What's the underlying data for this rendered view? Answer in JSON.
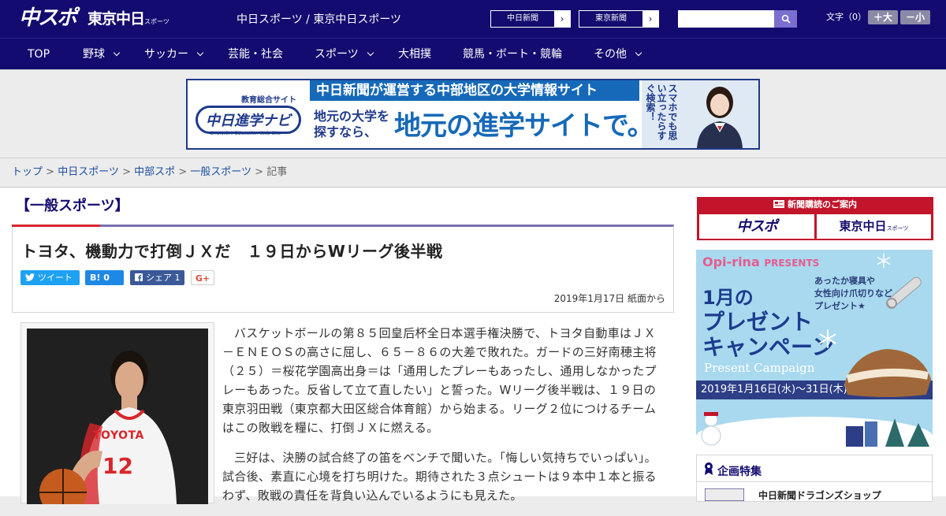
{
  "header": {
    "logo_main": "中スポ",
    "logo_tokyo": "東京中日",
    "logo_tokyo_small": "スポーツ",
    "tagline": "中日スポーツ / 東京中日スポーツ",
    "btn_chunichi": "中日新聞",
    "btn_tokyo": "東京新聞",
    "search_placeholder": "",
    "font_size_label": "文字（0）",
    "font_bigger": "＋大",
    "font_smaller": "－小"
  },
  "nav": {
    "items": [
      {
        "label": "TOP"
      },
      {
        "label": "野球"
      },
      {
        "label": "サッカー"
      },
      {
        "label": "芸能・社会"
      },
      {
        "label": "スポーツ"
      },
      {
        "label": "大相撲"
      },
      {
        "label": "競馬・ボート・競輪"
      },
      {
        "label": "その他"
      }
    ]
  },
  "banner": {
    "caption": "教育総合サイト",
    "logo": "中日進学ナビ",
    "logo_sub": "CHUNICHI Education Web Site",
    "top_text": "中日新聞が運営する中部地区の大学情報サイト",
    "small_text_1": "地元の大学を",
    "small_text_2": "探すなら、",
    "big_text": "地元の進学サイトで。",
    "vertical_text": "スマホでも思い立ったらすぐ検索！"
  },
  "breadcrumb": {
    "items": [
      "トップ",
      "中日スポーツ",
      "中部スポ",
      "一般スポーツ"
    ],
    "current": "記事",
    "sep": " > "
  },
  "article": {
    "section": "【一般スポーツ】",
    "headline": "トヨタ、機動力で打倒ＪＸだ　１９日からWリーグ後半戦",
    "share": {
      "tweet": "ツイート",
      "hatena": "B! 0",
      "facebook": "シェア 1",
      "gplus": "G+"
    },
    "dateline": "2019年1月17日 紙面から",
    "paragraphs": [
      "バスケットボールの第８５回皇后杯全日本選手権決勝で、トヨタ自動車はＪＸ－ＥＮＥＯＳの高さに屈し、６５－８６の大差で敗れた。ガードの三好南穂主将（２５）＝桜花学園高出身＝は「通用したプレーもあったし、通用しなかったプレーもあった。反省して立て直したい」と誓った。Wリーグ後半戦は、１９日の東京羽田戦（東京都大田区総合体育館）から始まる。リーグ２位につけるチームはこの敗戦を糧に、打倒ＪＸに燃える。",
      "三好は、決勝の試合終了の笛をベンチで聞いた。「悔しい気持ちでいっぱい」。試合後、素直に心境を打ち明けた。期待された３点シュートは９本中１本と振るわず、敗戦の責任を背負い込んでいるようにも見えた。"
    ],
    "photo": {
      "jersey_team": "TOYOTA",
      "jersey_number": "12"
    }
  },
  "sidebar": {
    "subscribe_header": "新聞購読のご案内",
    "subscribe_btn1": "中スポ",
    "subscribe_btn2": "東京中日",
    "subscribe_btn2_small": "スポーツ",
    "ad": {
      "brand": "Opi-rina",
      "brand_suffix": "PRESENTS",
      "sub_1": "あったか寝具や",
      "sub_2": "女性向け爪切りなど",
      "sub_3": "プレゼント★",
      "big_1": "1月の",
      "big_2": "プレゼント",
      "big_3": "キャンペーン",
      "present_campaign": "Present Campaign",
      "date": "2019年1月16日(水)〜31日(木)"
    },
    "feature_title": "企画特集",
    "feature_item": "中日新聞ドラゴンズショップ"
  },
  "colors": {
    "header_bg": "#130b6f",
    "accent_red": "#d8262b",
    "link_blue": "#1a4fa0"
  }
}
